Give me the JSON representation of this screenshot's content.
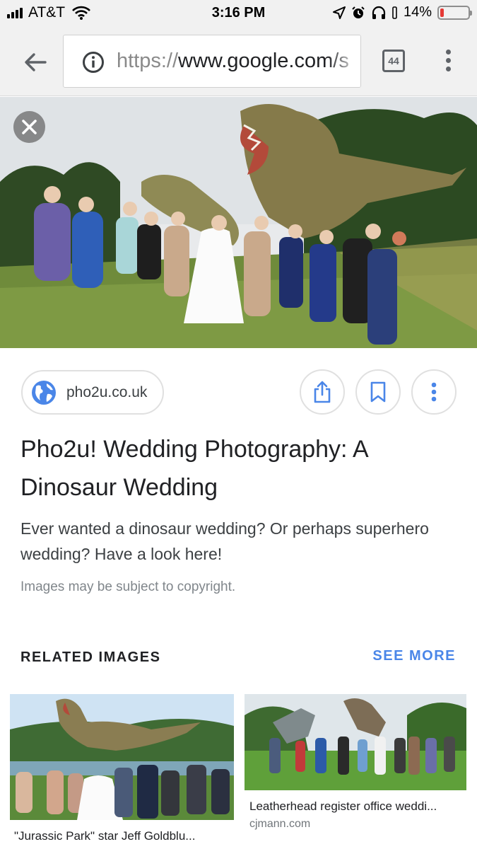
{
  "status_bar": {
    "carrier": "AT&T",
    "time": "3:16 PM",
    "battery": "14%",
    "battery_level": 0.14,
    "icons": [
      "signal-icon",
      "wifi-icon",
      "location-icon",
      "alarm-icon",
      "headphones-icon",
      "battery-icon"
    ]
  },
  "toolbar": {
    "url_scheme": "https://",
    "url_host": "www.google.com/s",
    "tab_count": "44",
    "icons": [
      "back-arrow-icon",
      "info-icon",
      "tabs-icon",
      "more-vert-icon"
    ]
  },
  "result": {
    "source": "pho2u.co.uk",
    "title": "Pho2u! Wedding Photography: A Dinosaur Wedding",
    "description": "Ever wanted a dinosaur wedding? Or perhaps superhero wedding? Have a look here!",
    "copyright": "Images may be subject to copyright.",
    "actions": [
      "share-icon",
      "bookmark-icon",
      "more-vert-icon"
    ]
  },
  "related": {
    "heading": "RELATED IMAGES",
    "see_more": "SEE MORE",
    "items": [
      {
        "caption": "\"Jurassic Park\" star Jeff Goldblu...",
        "source": ""
      },
      {
        "caption": "Leatherhead register office weddi...",
        "source": "cjmann.com"
      }
    ]
  },
  "colors": {
    "accent": "#4a86e8",
    "chrome": "#f1f1f1",
    "battery_low": "#e53935"
  }
}
